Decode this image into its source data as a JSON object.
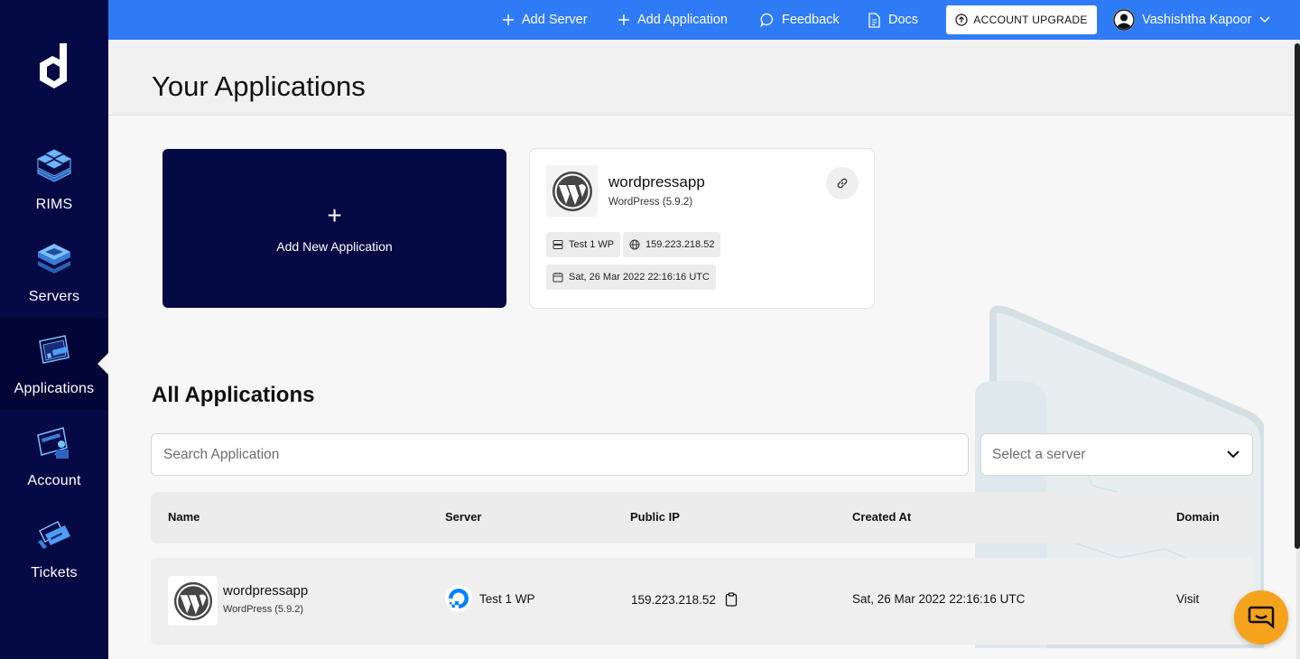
{
  "sidebar": {
    "logo_icon": "dcube-logo-icon",
    "items": [
      {
        "label": "RIMS",
        "icon": "rims-cubes-icon"
      },
      {
        "label": "Servers",
        "icon": "server-stack-icon"
      },
      {
        "label": "Applications",
        "icon": "applications-icon",
        "active": true
      },
      {
        "label": "Account",
        "icon": "account-card-icon"
      },
      {
        "label": "Tickets",
        "icon": "tickets-icon"
      }
    ]
  },
  "topbar": {
    "add_server": "Add Server",
    "add_application": "Add Application",
    "feedback": "Feedback",
    "docs": "Docs",
    "upgrade": "ACCOUNT UPGRADE",
    "user_name": "Vashishtha Kapoor"
  },
  "page": {
    "title": "Your Applications"
  },
  "add_card": {
    "label": "Add New Application"
  },
  "app_card": {
    "name": "wordpressapp",
    "sub": "WordPress (5.9.2)",
    "server": "Test 1 WP",
    "ip": "159.223.218.52",
    "created": "Sat, 26 Mar 2022 22:16:16 UTC"
  },
  "all_apps": {
    "title": "All Applications",
    "search_placeholder": "Search Application",
    "select_placeholder": "Select a server",
    "columns": [
      "Name",
      "Server",
      "Public IP",
      "Created At",
      "Domain"
    ],
    "rows": [
      {
        "name": "wordpressapp",
        "sub": "WordPress (5.9.2)",
        "server": "Test 1 WP",
        "ip": "159.223.218.52",
        "created": "Sat, 26 Mar 2022 22:16:16 UTC",
        "domain": "Visit"
      }
    ]
  },
  "colors": {
    "sidebar_bg": "#050a45",
    "topbar_bg": "#2f7bf5",
    "chat_button": "#f5a21d"
  }
}
